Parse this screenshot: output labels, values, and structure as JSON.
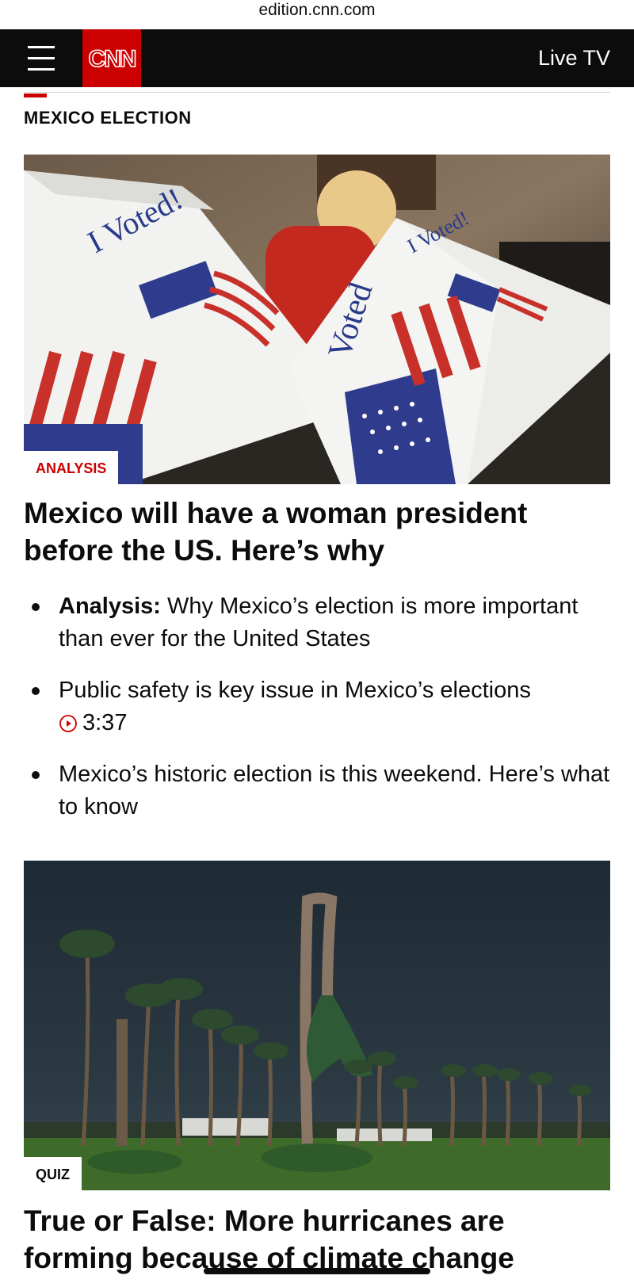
{
  "browser": {
    "url": "edition.cnn.com"
  },
  "header": {
    "logo": "CNN",
    "live_tv": "Live TV"
  },
  "section": {
    "title": "MEXICO ELECTION"
  },
  "lead_story": {
    "tag": "ANALYSIS",
    "headline": "Mexico will have a woman president before the US. Here’s why",
    "image_text": {
      "sign_a": "I Voted!",
      "sign_b": "Voted",
      "sign_c": "I Voted!"
    }
  },
  "related": [
    {
      "prefix": "Analysis:",
      "text": " Why Mexico’s election is more important than ever for the United States"
    },
    {
      "text": "Public safety is key issue in Mexico’s elections ",
      "duration": "3:37"
    },
    {
      "text": "Mexico’s historic election is this weekend. Here’s what to know"
    }
  ],
  "second_story": {
    "tag": "QUIZ",
    "headline": "True or False: More hurricanes are forming because of climate change"
  },
  "colors": {
    "brand_red": "#cc0000",
    "header_bg": "#0c0c0c"
  }
}
